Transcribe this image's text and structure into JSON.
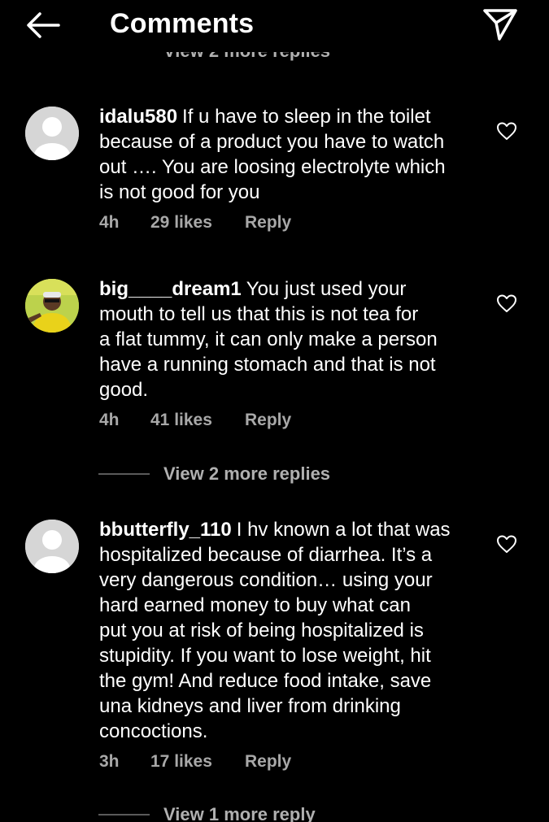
{
  "header": {
    "title": "Comments",
    "back_icon": "arrow-left-icon",
    "share_icon": "paper-plane-icon"
  },
  "clipped_replies_label": "View 2 more replies",
  "comments": [
    {
      "username": "idalu580",
      "text": "If u have to sleep in the toilet\nbecause of a product you have to watch\nout …. You are loosing electrolyte which\nis not good for you",
      "time": "4h",
      "likes": "29 likes",
      "reply": "Reply"
    },
    {
      "username": "big____dream1",
      "text": "You just used your\nmouth to tell us that this is not tea for\na flat tummy, it can only make a person\nhave a running stomach and that is not\ngood.",
      "time": "4h",
      "likes": "41 likes",
      "reply": "Reply",
      "view_replies": "View 2 more replies"
    },
    {
      "username": "bbutterfly_110",
      "text": "I hv known a lot that was\nhospitalized because of diarrhea. It’s a\nvery dangerous condition… using your\nhard earned money to buy what can\nput you at risk of being hospitalized is\nstupidity. If you want to lose weight, hit\nthe gym! And reduce food intake, save\nuna kidneys and liver from drinking\nconcoctions.",
      "time": "3h",
      "likes": "17 likes",
      "reply": "Reply",
      "view_replies": "View 1 more reply"
    }
  ],
  "colors": {
    "background": "#000000",
    "text": "#ffffff",
    "meta": "#a8a8a8",
    "avatar_placeholder": "#d6d6d6"
  }
}
